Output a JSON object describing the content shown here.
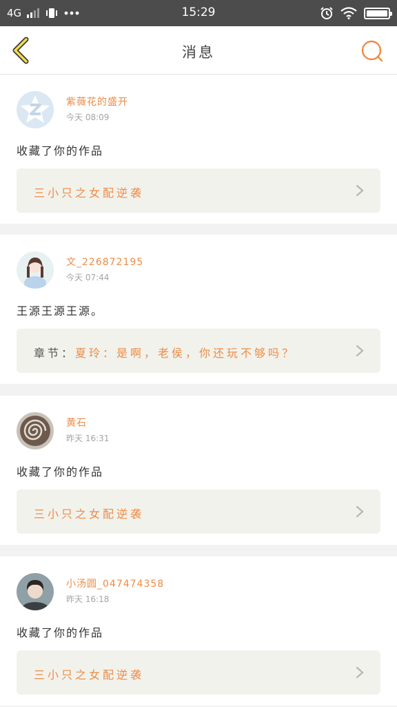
{
  "status_bar": {
    "network": "4G",
    "time": "15:29"
  },
  "header": {
    "title": "消息",
    "back_icon": "chevron-left-icon",
    "search_icon": "search-icon",
    "accent_color": "#ef8a44"
  },
  "messages": [
    {
      "user": "紫薇花的盛开",
      "time": "今天 08:09",
      "action": "收藏了你的作品",
      "reference": {
        "prefix": "",
        "text": "三小只之女配逆袭"
      }
    },
    {
      "user": "文_226872195",
      "time": "今天 07:44",
      "action": "王源王源王源。",
      "reference": {
        "prefix": "章节：",
        "text": "夏玲：是啊，老侯，你还玩不够吗？"
      }
    },
    {
      "user": "黄石",
      "time": "昨天 16:31",
      "action": "收藏了你的作品",
      "reference": {
        "prefix": "",
        "text": "三小只之女配逆袭"
      }
    },
    {
      "user": "小汤圆_047474358",
      "time": "昨天 16:18",
      "action": "收藏了你的作品",
      "reference": {
        "prefix": "",
        "text": "三小只之女配逆袭"
      }
    }
  ]
}
